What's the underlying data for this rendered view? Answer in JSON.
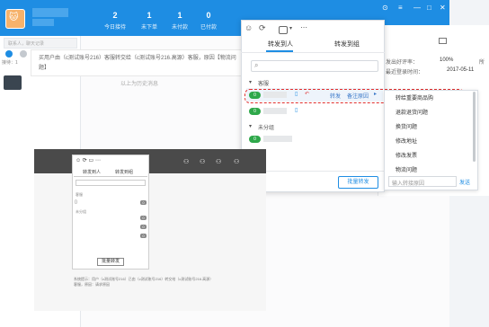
{
  "header": {
    "stats": [
      {
        "value": "2",
        "label": "今日接待"
      },
      {
        "value": "1",
        "label": "未下单"
      },
      {
        "value": "1",
        "label": "未付款"
      },
      {
        "value": "0",
        "label": "已付款"
      }
    ],
    "window_controls": [
      "⊙",
      "≡",
      "—",
      "□",
      "✕"
    ]
  },
  "sidebar": {
    "search_placeholder": "联系人，聊天记录",
    "unread_label": "接待：1"
  },
  "chat": {
    "system_message": "买用户由（c测试账号216）客服转交给（c测试账号216.高源）客服，原因【物流问题】",
    "history_divider": "以上为历史消息"
  },
  "right_panel": {
    "good_rate_label": "发出好评率：",
    "good_rate_value": "100%",
    "last_login_label": "最近登录时间：",
    "last_login_value": "2017-05-11",
    "extra_label": "所"
  },
  "transfer_popup": {
    "tabs": [
      "转发到人",
      "转发到组"
    ],
    "groups": [
      {
        "name": "客服",
        "rows": [
          {
            "badge": "0",
            "action": "转发",
            "note": "备注原因"
          },
          {
            "badge": "0"
          }
        ]
      },
      {
        "name": "未分组",
        "rows": [
          {
            "badge": "0"
          }
        ]
      }
    ],
    "bulk_button": "批量转发"
  },
  "reason_menu": {
    "items": [
      "转给重要商品购",
      "退款退货问题",
      "换货问题",
      "修改地址",
      "修改发票",
      "物流问题"
    ],
    "input_placeholder": "输入转接原因",
    "send_label": "发送"
  },
  "thumbnail": {
    "tabs": [
      "转发到人",
      "转发到组"
    ],
    "group_a": "客服",
    "group_b": "未分组",
    "badges": [
      "0",
      "0",
      "0",
      "0"
    ],
    "bulk_button": "批量转发",
    "sys_msg_line1": "系统提示：用户（c测试账号216）已由（c测试账号216）转交给（c测试账号216.高源）",
    "sys_msg_line2": "客服，原因：请求原因"
  },
  "colors": {
    "brand": "#1e8de3",
    "badge_green": "#2ea84a",
    "highlight_outline": "#e02f2f"
  }
}
